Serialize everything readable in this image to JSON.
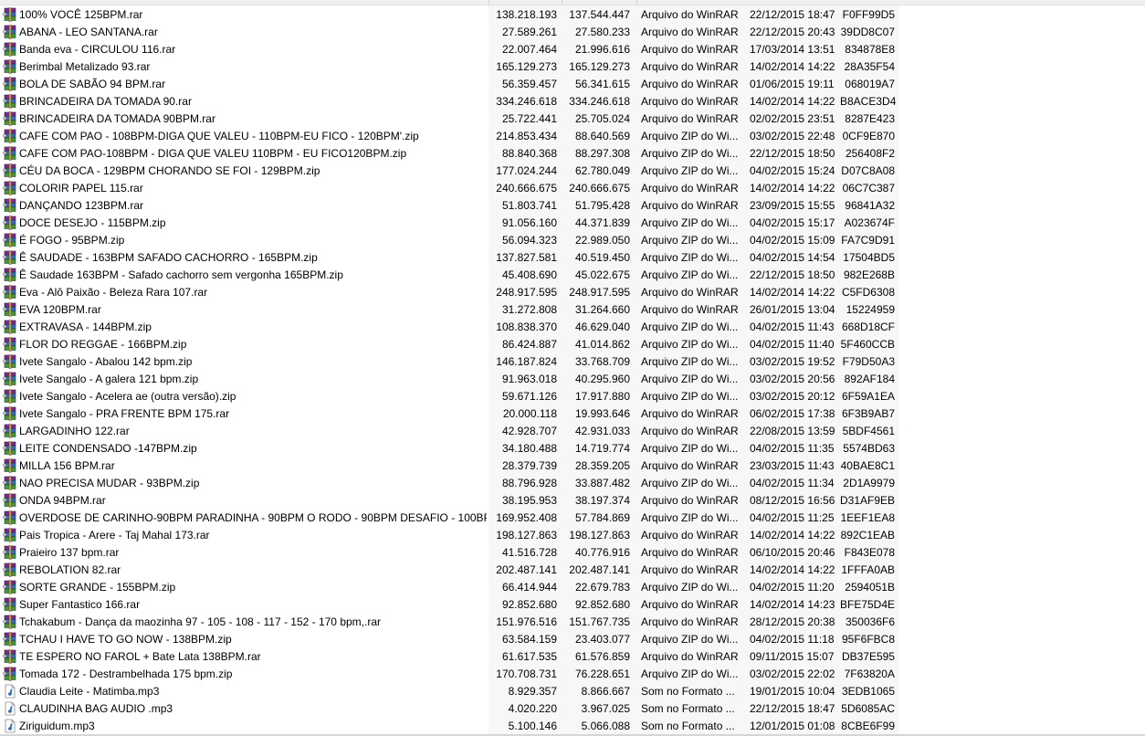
{
  "file_list": {
    "rows": [
      {
        "name": "100% VOCÊ 125BPM.rar",
        "size": "138.218.193",
        "packed": "137.544.447",
        "type": "Arquivo do WinRAR",
        "modified": "22/12/2015 18:47",
        "crc": "F0FF99D5",
        "icon": "winrar-archive-icon"
      },
      {
        "name": "ABANA - LEO SANTANA.rar",
        "size": "27.589.261",
        "packed": "27.580.233",
        "type": "Arquivo do WinRAR",
        "modified": "22/12/2015 20:43",
        "crc": "39DD8C07",
        "icon": "winrar-archive-icon"
      },
      {
        "name": "Banda eva - CIRCULOU 116.rar",
        "size": "22.007.464",
        "packed": "21.996.616",
        "type": "Arquivo do WinRAR",
        "modified": "17/03/2014 13:51",
        "crc": "834878E8",
        "icon": "winrar-archive-icon"
      },
      {
        "name": "Berimbal Metalizado 93.rar",
        "size": "165.129.273",
        "packed": "165.129.273",
        "type": "Arquivo do WinRAR",
        "modified": "14/02/2014 14:22",
        "crc": "28A35F54",
        "icon": "winrar-archive-icon"
      },
      {
        "name": "BOLA DE SABÃO 94 BPM.rar",
        "size": "56.359.457",
        "packed": "56.341.615",
        "type": "Arquivo do WinRAR",
        "modified": "01/06/2015 19:11",
        "crc": "068019A7",
        "icon": "winrar-archive-icon"
      },
      {
        "name": "BRINCADEIRA DA TOMADA 90.rar",
        "size": "334.246.618",
        "packed": "334.246.618",
        "type": "Arquivo do WinRAR",
        "modified": "14/02/2014 14:22",
        "crc": "B8ACE3D4",
        "icon": "winrar-archive-icon"
      },
      {
        "name": "BRINCADEIRA DA TOMADA 90BPM.rar",
        "size": "25.722.441",
        "packed": "25.705.024",
        "type": "Arquivo do WinRAR",
        "modified": "02/02/2015 23:51",
        "crc": "8287E423",
        "icon": "winrar-archive-icon"
      },
      {
        "name": "CAFE COM PAO - 108BPM-DIGA QUE VALEU - 110BPM-EU FICO - 120BPM'.zip",
        "size": "214.853.434",
        "packed": "88.640.569",
        "type": "Arquivo ZIP do Wi...",
        "modified": "03/02/2015 22:48",
        "crc": "0CF9E870",
        "icon": "winrar-archive-icon"
      },
      {
        "name": "CAFE COM PAO-108BPM - DIGA QUE VALEU 110BPM - EU FICO120BPM.zip",
        "size": "88.840.368",
        "packed": "88.297.308",
        "type": "Arquivo ZIP do Wi...",
        "modified": "22/12/2015 18:50",
        "crc": "256408F2",
        "icon": "winrar-archive-icon"
      },
      {
        "name": "CÉU DA BOCA - 129BPM CHORANDO SE FOI - 129BPM.zip",
        "size": "177.024.244",
        "packed": "62.780.049",
        "type": "Arquivo ZIP do Wi...",
        "modified": "04/02/2015 15:24",
        "crc": "D07C8A08",
        "icon": "winrar-archive-icon"
      },
      {
        "name": "COLORIR PAPEL 115.rar",
        "size": "240.666.675",
        "packed": "240.666.675",
        "type": "Arquivo do WinRAR",
        "modified": "14/02/2014 14:22",
        "crc": "06C7C387",
        "icon": "winrar-archive-icon"
      },
      {
        "name": "DANÇANDO 123BPM.rar",
        "size": "51.803.741",
        "packed": "51.795.428",
        "type": "Arquivo do WinRAR",
        "modified": "23/09/2015 15:55",
        "crc": "96841A32",
        "icon": "winrar-archive-icon"
      },
      {
        "name": "DOCE DESEJO - 115BPM.zip",
        "size": "91.056.160",
        "packed": "44.371.839",
        "type": "Arquivo ZIP do Wi...",
        "modified": "04/02/2015 15:17",
        "crc": "A023674F",
        "icon": "winrar-archive-icon"
      },
      {
        "name": "É FOGO - 95BPM.zip",
        "size": "56.094.323",
        "packed": "22.989.050",
        "type": "Arquivo ZIP do Wi...",
        "modified": "04/02/2015 15:09",
        "crc": "FA7C9D91",
        "icon": "winrar-archive-icon"
      },
      {
        "name": "Ê SAUDADE - 163BPM SAFADO CACHORRO - 165BPM.zip",
        "size": "137.827.581",
        "packed": "40.519.450",
        "type": "Arquivo ZIP do Wi...",
        "modified": "04/02/2015 14:54",
        "crc": "17504BD5",
        "icon": "winrar-archive-icon"
      },
      {
        "name": "Ê Saudade 163BPM - Safado cachorro sem vergonha 165BPM.zip",
        "size": "45.408.690",
        "packed": "45.022.675",
        "type": "Arquivo ZIP do Wi...",
        "modified": "22/12/2015 18:50",
        "crc": "982E268B",
        "icon": "winrar-archive-icon"
      },
      {
        "name": "Eva - Alô Paixão - Beleza Rara 107.rar",
        "size": "248.917.595",
        "packed": "248.917.595",
        "type": "Arquivo do WinRAR",
        "modified": "14/02/2014 14:22",
        "crc": "C5FD6308",
        "icon": "winrar-archive-icon"
      },
      {
        "name": "EVA 120BPM.rar",
        "size": "31.272.808",
        "packed": "31.264.660",
        "type": "Arquivo do WinRAR",
        "modified": "26/01/2015 13:04",
        "crc": "15224959",
        "icon": "winrar-archive-icon"
      },
      {
        "name": "EXTRAVASA - 144BPM.zip",
        "size": "108.838.370",
        "packed": "46.629.040",
        "type": "Arquivo ZIP do Wi...",
        "modified": "04/02/2015 11:43",
        "crc": "668D18CF",
        "icon": "winrar-archive-icon"
      },
      {
        "name": "FLOR DO REGGAE - 166BPM.zip",
        "size": "86.424.887",
        "packed": "41.014.862",
        "type": "Arquivo ZIP do Wi...",
        "modified": "04/02/2015 11:40",
        "crc": "5F460CCB",
        "icon": "winrar-archive-icon"
      },
      {
        "name": "Ivete  Sangalo - Abalou 142 bpm.zip",
        "size": "146.187.824",
        "packed": "33.768.709",
        "type": "Arquivo ZIP do Wi...",
        "modified": "03/02/2015 19:52",
        "crc": "F79D50A3",
        "icon": "winrar-archive-icon"
      },
      {
        "name": "Ivete Sangalo - A galera 121 bpm.zip",
        "size": "91.963.018",
        "packed": "40.295.960",
        "type": "Arquivo ZIP do Wi...",
        "modified": "03/02/2015 20:56",
        "crc": "892AF184",
        "icon": "winrar-archive-icon"
      },
      {
        "name": "Ivete Sangalo - Acelera ae (outra versão).zip",
        "size": "59.671.126",
        "packed": "17.917.880",
        "type": "Arquivo ZIP do Wi...",
        "modified": "03/02/2015 20:12",
        "crc": "6F59A1EA",
        "icon": "winrar-archive-icon"
      },
      {
        "name": "Ivete Sangalo - PRA FRENTE BPM 175.rar",
        "size": "20.000.118",
        "packed": "19.993.646",
        "type": "Arquivo do WinRAR",
        "modified": "06/02/2015 17:38",
        "crc": "6F3B9AB7",
        "icon": "winrar-archive-icon"
      },
      {
        "name": "LARGADINHO 122.rar",
        "size": "42.928.707",
        "packed": "42.931.033",
        "type": "Arquivo do WinRAR",
        "modified": "22/08/2015 13:59",
        "crc": "5BDF4561",
        "icon": "winrar-archive-icon"
      },
      {
        "name": "LEITE CONDENSADO -147BPM.zip",
        "size": "34.180.488",
        "packed": "14.719.774",
        "type": "Arquivo ZIP do Wi...",
        "modified": "04/02/2015 11:35",
        "crc": "5574BD63",
        "icon": "winrar-archive-icon"
      },
      {
        "name": "MILLA 156 BPM.rar",
        "size": "28.379.739",
        "packed": "28.359.205",
        "type": "Arquivo do WinRAR",
        "modified": "23/03/2015 11:43",
        "crc": "40BAE8C1",
        "icon": "winrar-archive-icon"
      },
      {
        "name": "NAO PRECISA MUDAR - 93BPM.zip",
        "size": "88.796.928",
        "packed": "33.887.482",
        "type": "Arquivo ZIP do Wi...",
        "modified": "04/02/2015 11:34",
        "crc": "2D1A9979",
        "icon": "winrar-archive-icon"
      },
      {
        "name": "ONDA 94BPM.rar",
        "size": "38.195.953",
        "packed": "38.197.374",
        "type": "Arquivo do WinRAR",
        "modified": "08/12/2015 16:56",
        "crc": "D31AF9EB",
        "icon": "winrar-archive-icon"
      },
      {
        "name": "OVERDOSE DE CARINHO-90BPM PARADINHA - 90BPM O RODO - 90BPM DESAFIO - 100BPM.zip",
        "size": "169.952.408",
        "packed": "57.784.869",
        "type": "Arquivo ZIP do Wi...",
        "modified": "04/02/2015 11:25",
        "crc": "1EEF1EA8",
        "icon": "winrar-archive-icon"
      },
      {
        "name": "Pais Tropica - Arere - Taj Mahal 173.rar",
        "size": "198.127.863",
        "packed": "198.127.863",
        "type": "Arquivo do WinRAR",
        "modified": "14/02/2014 14:22",
        "crc": "892C1EAB",
        "icon": "winrar-archive-icon"
      },
      {
        "name": "Praieiro 137 bpm.rar",
        "size": "41.516.728",
        "packed": "40.776.916",
        "type": "Arquivo do WinRAR",
        "modified": "06/10/2015 20:46",
        "crc": "F843E078",
        "icon": "winrar-archive-icon"
      },
      {
        "name": "REBOLATION 82.rar",
        "size": "202.487.141",
        "packed": "202.487.141",
        "type": "Arquivo do WinRAR",
        "modified": "14/02/2014 14:22",
        "crc": "1FFFA0AB",
        "icon": "winrar-archive-icon"
      },
      {
        "name": "SORTE GRANDE - 155BPM.zip",
        "size": "66.414.944",
        "packed": "22.679.783",
        "type": "Arquivo ZIP do Wi...",
        "modified": "04/02/2015 11:20",
        "crc": "2594051B",
        "icon": "winrar-archive-icon"
      },
      {
        "name": "Super Fantastico 166.rar",
        "size": "92.852.680",
        "packed": "92.852.680",
        "type": "Arquivo do WinRAR",
        "modified": "14/02/2014 14:23",
        "crc": "BFE75D4E",
        "icon": "winrar-archive-icon"
      },
      {
        "name": "Tchakabum - Dança da maozinha 97 - 105 - 108 - 117 - 152 - 170 bpm,.rar",
        "size": "151.976.516",
        "packed": "151.767.735",
        "type": "Arquivo do WinRAR",
        "modified": "28/12/2015 20:38",
        "crc": "350036F6",
        "icon": "winrar-archive-icon"
      },
      {
        "name": "TCHAU I HAVE TO GO NOW - 138BPM.zip",
        "size": "63.584.159",
        "packed": "23.403.077",
        "type": "Arquivo ZIP do Wi...",
        "modified": "04/02/2015 11:18",
        "crc": "95F6FBC8",
        "icon": "winrar-archive-icon"
      },
      {
        "name": "TE ESPERO NO FAROL + Bate Lata 138BPM.rar",
        "size": "61.617.535",
        "packed": "61.576.859",
        "type": "Arquivo do WinRAR",
        "modified": "09/11/2015 15:07",
        "crc": "DB37E595",
        "icon": "winrar-archive-icon"
      },
      {
        "name": "Tomada 172 - Destrambelhada 175 bpm.zip",
        "size": "170.708.731",
        "packed": "76.228.651",
        "type": "Arquivo ZIP do Wi...",
        "modified": "03/02/2015 22:02",
        "crc": "7F63820A",
        "icon": "winrar-archive-icon"
      },
      {
        "name": "Claudia Leite - Matimba.mp3",
        "size": "8.929.357",
        "packed": "8.866.667",
        "type": "Som no Formato ...",
        "modified": "19/01/2015 10:04",
        "crc": "3EDB1065",
        "icon": "audio-file-icon"
      },
      {
        "name": "CLAUDINHA BAG AUDIO .mp3",
        "size": "4.020.220",
        "packed": "3.967.025",
        "type": "Som no Formato ...",
        "modified": "22/12/2015 18:47",
        "crc": "5D6085AC",
        "icon": "audio-file-icon"
      },
      {
        "name": "Ziriguidum.mp3",
        "size": "5.100.146",
        "packed": "5.066.088",
        "type": "Som no Formato ...",
        "modified": "12/01/2015 01:08",
        "crc": "8CBE6F99",
        "icon": "audio-file-icon"
      }
    ]
  },
  "colors": {
    "text": "#000000",
    "background": "#ffffff",
    "column_band": "#f6f7f9"
  }
}
